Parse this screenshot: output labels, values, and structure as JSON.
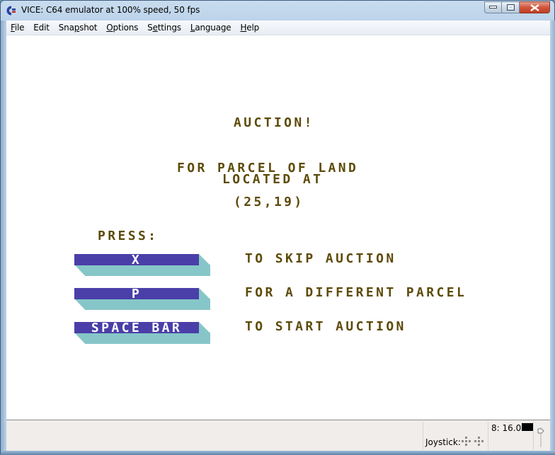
{
  "window": {
    "title": "VICE: C64 emulator at 100% speed, 50 fps",
    "icon": "commodore-logo-icon",
    "controls": [
      "minimize",
      "maximize",
      "close"
    ]
  },
  "menubar": {
    "items": [
      {
        "label": "File",
        "mnemonic": "F",
        "rest": "ile"
      },
      {
        "label": "Edit",
        "mnemonic": "",
        "rest": "Edit"
      },
      {
        "label": "Snapshot",
        "pre": "Sna",
        "mnemonic": "p",
        "rest": "shot"
      },
      {
        "label": "Options",
        "mnemonic": "O",
        "rest": "ptions"
      },
      {
        "label": "Settings",
        "pre": "S",
        "mnemonic": "e",
        "rest": "ttings"
      },
      {
        "label": "Language",
        "mnemonic": "L",
        "rest": "anguage"
      },
      {
        "label": "Help",
        "mnemonic": "H",
        "rest": "elp"
      }
    ]
  },
  "screen": {
    "title": "AUCTION!",
    "line1": "FOR PARCEL OF LAND",
    "line2": "LOCATED AT",
    "coords": "(25,19)",
    "press_label": "PRESS:",
    "options": [
      {
        "key": "X",
        "description": "TO SKIP AUCTION"
      },
      {
        "key": "P",
        "description": "FOR A DIFFERENT PARCEL"
      },
      {
        "key": "SPACE BAR",
        "description": "TO START AUCTION"
      }
    ],
    "colors": {
      "background": "#ffffff",
      "text": "#5d4b0a",
      "key_face": "#4a3fa8",
      "key_shadow": "#86c6c8",
      "key_text": "#ffffff"
    }
  },
  "statusbar": {
    "drive_track": "8: 16.0",
    "joystick_label": "Joystick:",
    "drive_led_color": "#000000"
  }
}
